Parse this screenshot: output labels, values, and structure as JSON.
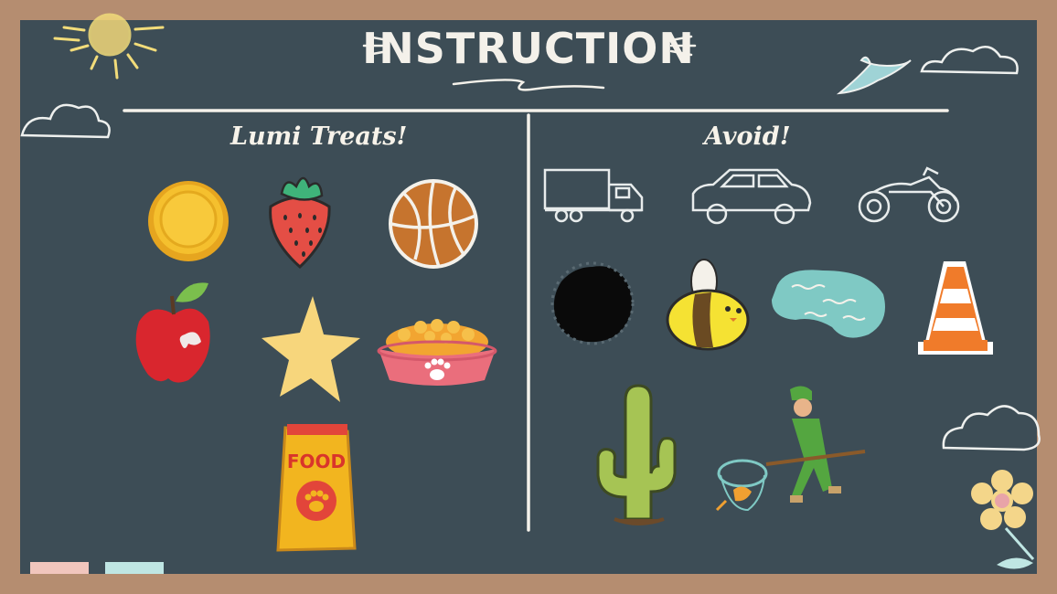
{
  "screen": {
    "title": "INSTRUCTION",
    "left_heading": "Lumi Treats!",
    "right_heading": "Avoid!"
  },
  "treats": [
    {
      "name": "coin",
      "icon": "gold-coin-icon"
    },
    {
      "name": "strawberry",
      "icon": "strawberry-icon"
    },
    {
      "name": "basketball",
      "icon": "basketball-icon"
    },
    {
      "name": "apple",
      "icon": "apple-icon"
    },
    {
      "name": "star",
      "icon": "star-icon"
    },
    {
      "name": "pet food bowl",
      "icon": "pet-food-bowl-icon"
    },
    {
      "name": "food bag",
      "icon": "food-bag-icon",
      "label": "FOOD"
    }
  ],
  "hazards": [
    {
      "name": "truck",
      "icon": "truck-icon"
    },
    {
      "name": "car",
      "icon": "car-icon"
    },
    {
      "name": "motorcycle",
      "icon": "motorcycle-icon"
    },
    {
      "name": "black hole",
      "icon": "black-hole-icon"
    },
    {
      "name": "bee",
      "icon": "bee-icon"
    },
    {
      "name": "puddle",
      "icon": "puddle-icon"
    },
    {
      "name": "traffic cone",
      "icon": "traffic-cone-icon"
    },
    {
      "name": "cactus",
      "icon": "cactus-icon"
    },
    {
      "name": "dog catcher",
      "icon": "dog-catcher-icon"
    }
  ],
  "colors": {
    "board": "#3d4d56",
    "frame": "#b58d70",
    "chalk": "#f4f1ea",
    "tab_pink": "#f1c6bd",
    "tab_teal": "#bfe6e3"
  }
}
